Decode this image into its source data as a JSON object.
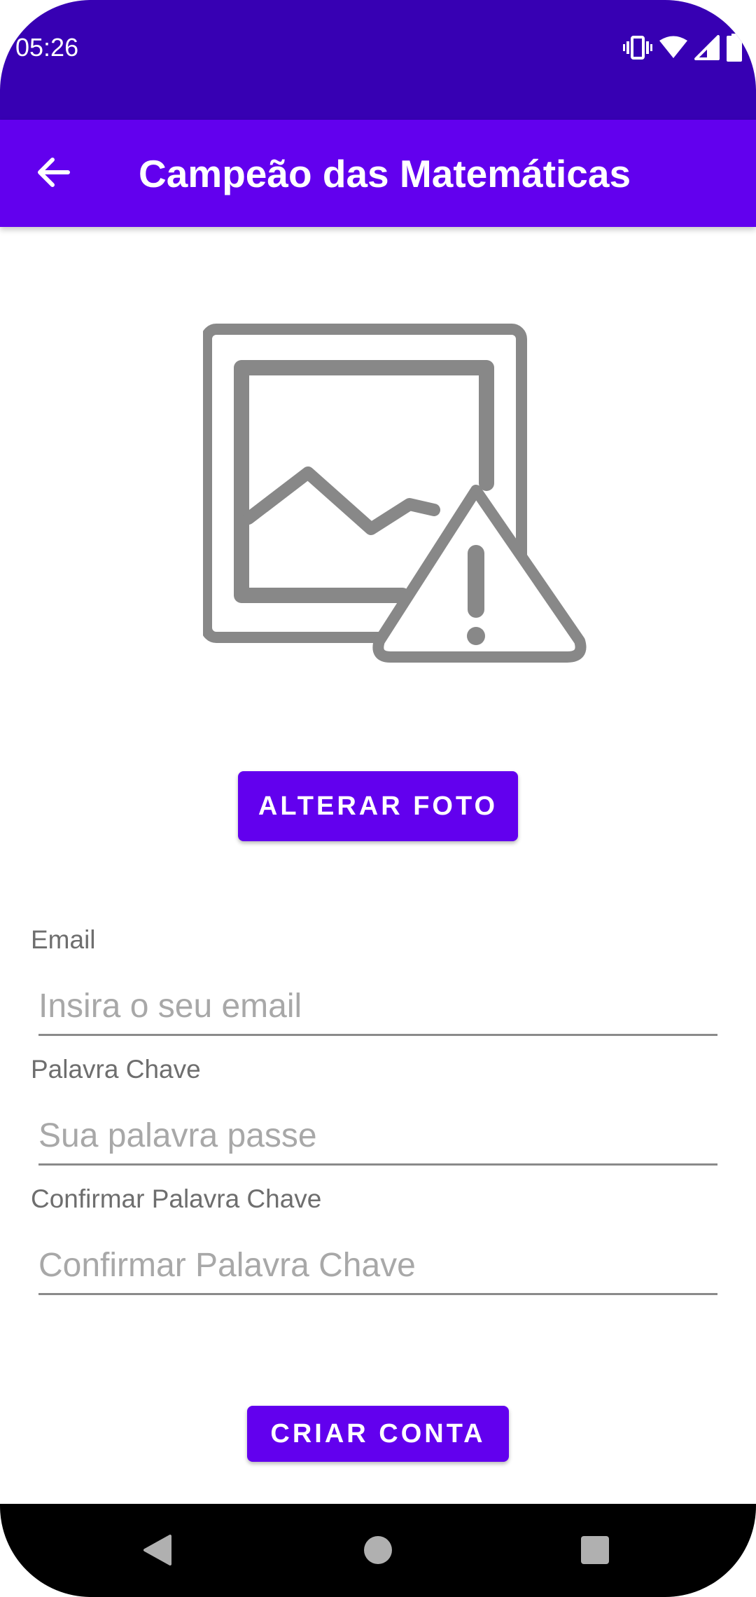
{
  "status_bar": {
    "time": "05:26",
    "icons": [
      "vibrate-icon",
      "wifi-icon",
      "cell-signal-icon",
      "battery-icon"
    ]
  },
  "app_bar": {
    "title": "Campeão das Matemáticas",
    "back_icon": "arrow-left-icon"
  },
  "photo": {
    "icon": "broken-image-icon"
  },
  "buttons": {
    "change_photo": "ALTERAR FOTO",
    "create_account": "CRIAR CONTA"
  },
  "form": {
    "email": {
      "label": "Email",
      "placeholder": "Insira o seu email",
      "value": ""
    },
    "password": {
      "label": "Palavra Chave",
      "placeholder": "Sua palavra passe",
      "value": ""
    },
    "confirm_password": {
      "label": "Confirmar Palavra Chave",
      "placeholder": "Confirmar Palavra Chave",
      "value": ""
    }
  },
  "nav_bar": {
    "icons": [
      "back-triangle-icon",
      "home-circle-icon",
      "recents-square-icon"
    ]
  },
  "colors": {
    "status_bar": "#3700b3",
    "primary": "#6200ee",
    "on_primary": "#ffffff",
    "nav_bar": "#000000"
  }
}
